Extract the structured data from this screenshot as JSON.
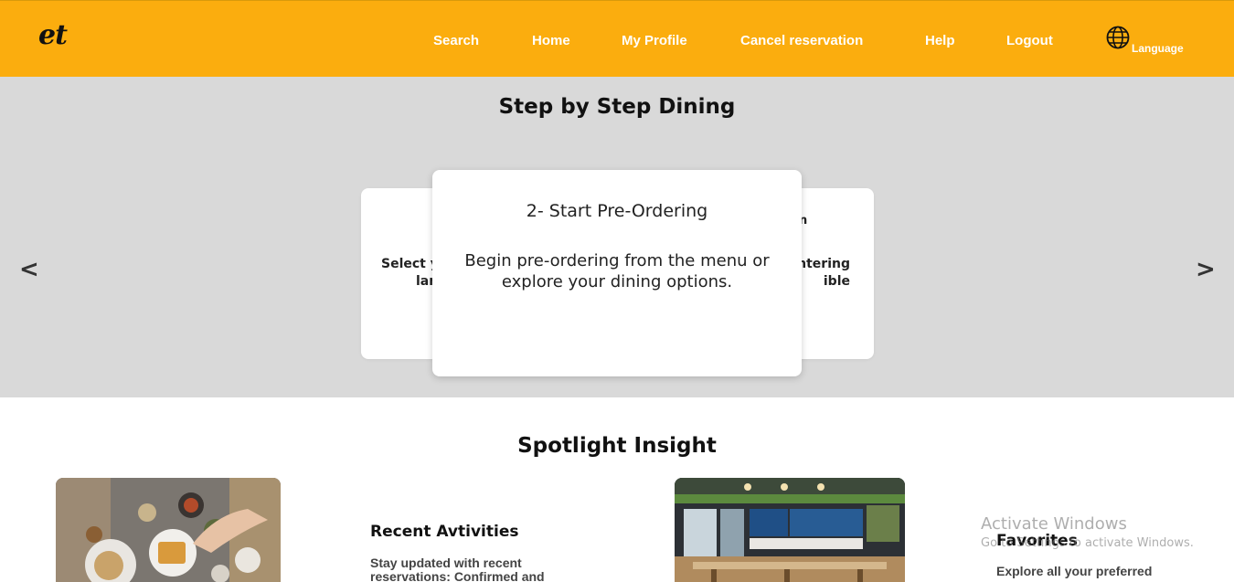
{
  "header": {
    "logo": "et",
    "nav": {
      "search": "Search",
      "home": "Home",
      "profile": "My Profile",
      "cancel": "Cancel reservation",
      "help": "Help",
      "logout": "Logout"
    },
    "language": "Language",
    "language_icon": "globe-icon",
    "accent_color": "#FBAD0E"
  },
  "steps": {
    "title": "Step by Step Dining",
    "prev_arrow": "<",
    "next_arrow": ">",
    "left_card": {
      "text_line1": "Select y",
      "text_line2": "lan"
    },
    "main_card": {
      "title": "2- Start Pre-Ordering",
      "text": "Begin pre-ordering from the menu or explore your dining options."
    },
    "right_card": {
      "title_fragment": "n",
      "text_line1": "ntering",
      "text_line2": "ible"
    },
    "background_color": "#D9D9D9"
  },
  "spotlight": {
    "title": "Spotlight Insight",
    "recent": {
      "title": "Recent Avtivities",
      "text": "Stay updated with recent reservations: Confirmed and"
    },
    "favorites": {
      "title": "Favorites",
      "text": "Explore all your preferred"
    }
  },
  "watermark": {
    "title": "Activate Windows",
    "subtitle": "Go to Settings to activate Windows."
  }
}
